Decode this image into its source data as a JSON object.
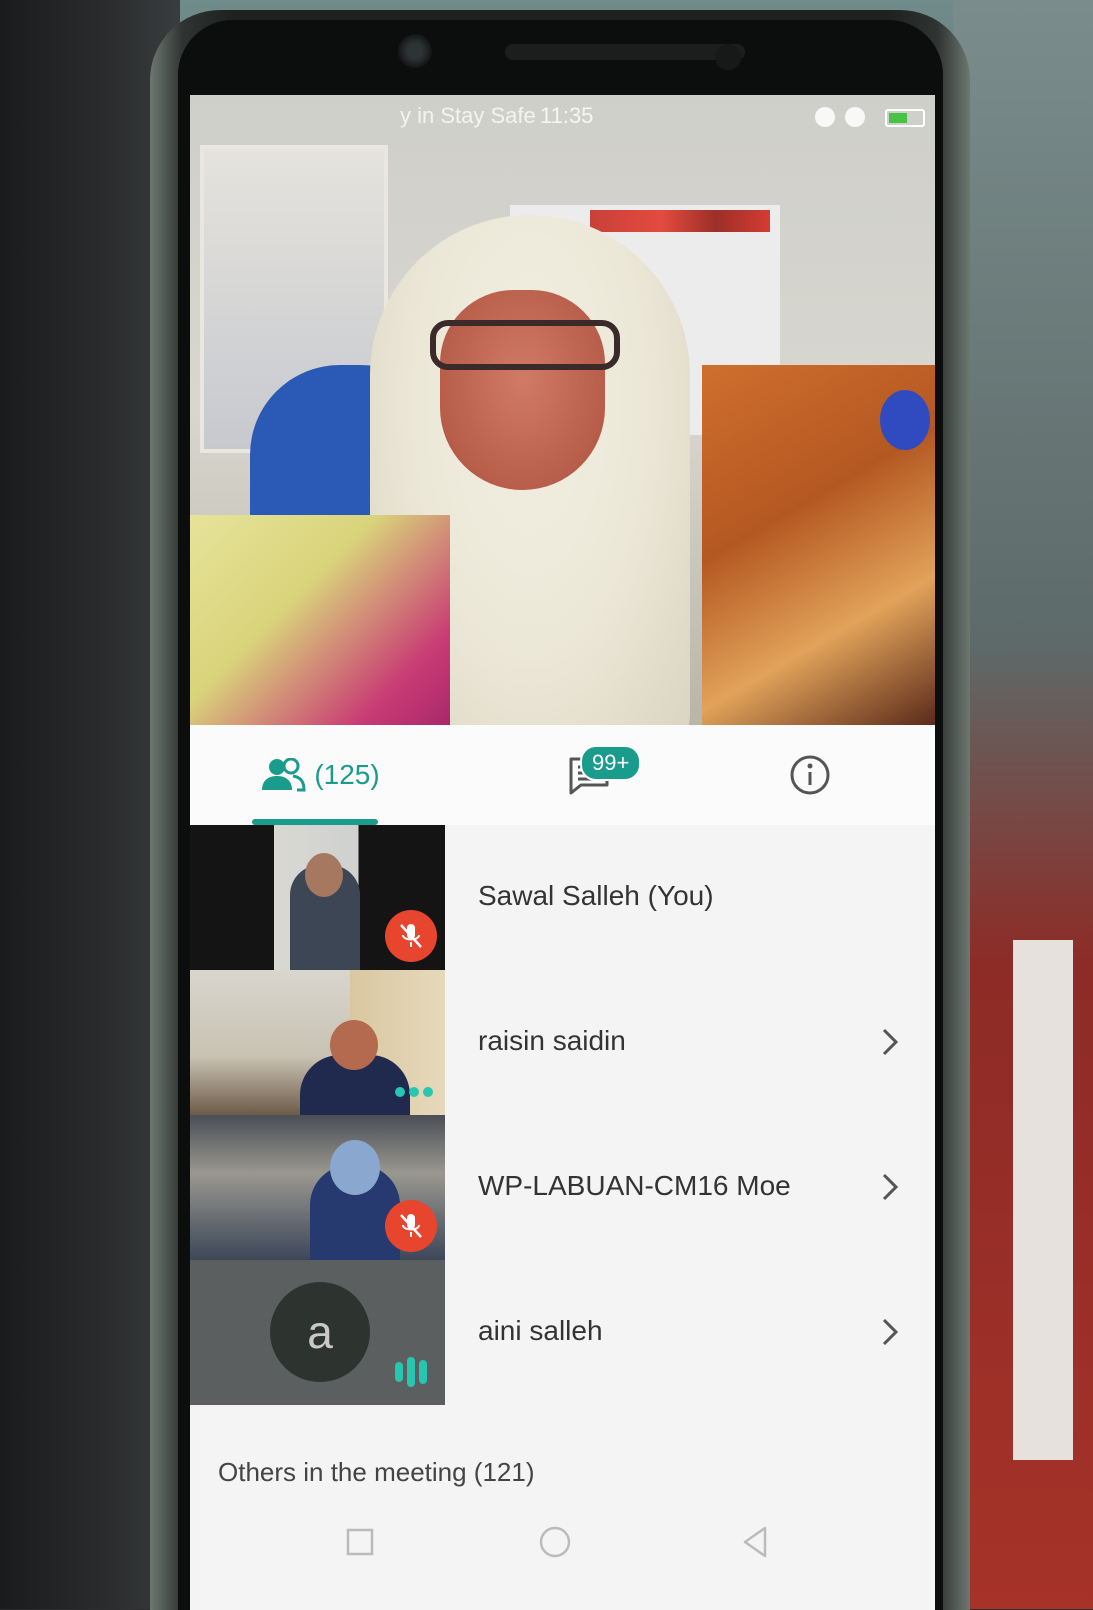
{
  "statusbar": {
    "text": "y in Stay Safe",
    "time": "11:35",
    "battery_level": 0.55
  },
  "tabs": {
    "participants_count": "(125)",
    "chat_badge": "99+",
    "participants_icon": "people-icon",
    "chat_icon": "chat-icon",
    "info_icon": "info-icon"
  },
  "participants": [
    {
      "name": "Sawal Salleh (You)",
      "status": "muted"
    },
    {
      "name": "raisin saidin",
      "status": "more"
    },
    {
      "name": "WP-LABUAN-CM16 Moe",
      "status": "muted"
    },
    {
      "name": "aini salleh",
      "status": "speaking",
      "avatar_letter": "a"
    }
  ],
  "others": {
    "label": "Others in the meeting (121)"
  },
  "colors": {
    "accent": "#1a9c8c",
    "muted_red": "#e8452f",
    "speaking": "#27c6b0"
  }
}
